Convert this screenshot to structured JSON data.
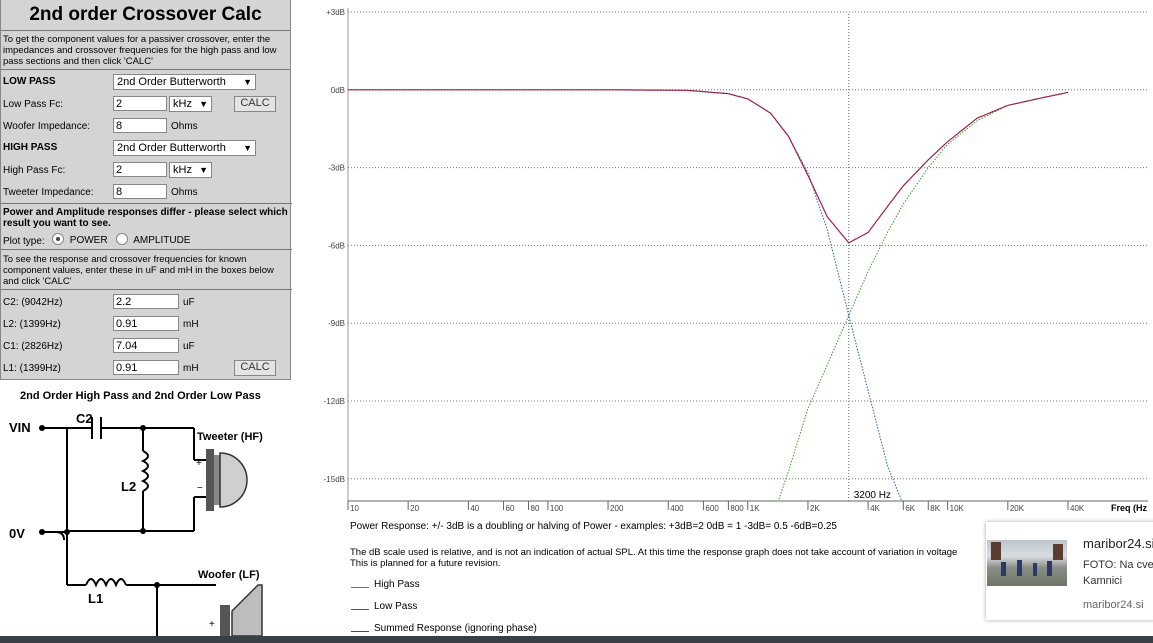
{
  "calculator": {
    "title": "2nd order Crossover Calc",
    "intro": "To get the component values for a passiver crossover, enter the impedances and crossover frequencies for the high pass and low pass sections and then click 'CALC'",
    "low_pass": {
      "heading": "LOW PASS",
      "filter_type": "2nd Order Butterworth",
      "fc_label": "Low Pass Fc:",
      "fc_value": "2",
      "fc_unit": "kHz",
      "calc_label": "CALC",
      "impedance_label": "Woofer Impedance:",
      "impedance_value": "8",
      "impedance_unit": "Ohms"
    },
    "high_pass": {
      "heading": "HIGH PASS",
      "filter_type": "2nd Order Butterworth",
      "fc_label": "High Pass Fc:",
      "fc_value": "2",
      "fc_unit": "kHz",
      "impedance_label": "Tweeter Impedance:",
      "impedance_value": "8",
      "impedance_unit": "Ohms"
    },
    "response_note": "Power and Amplitude responses differ - please select which result you want to see.",
    "plot_type": {
      "label": "Plot type:",
      "options": [
        "POWER",
        "AMPLITUDE"
      ],
      "selected": "POWER"
    },
    "known_intro": "To see the response and crossover frequencies for known component values, enter these in uF and mH in the boxes below and click 'CALC'",
    "components": [
      {
        "label": "C2: (9042Hz)",
        "value": "2.2",
        "unit": "uF"
      },
      {
        "label": "L2: (1399Hz)",
        "value": "0.91",
        "unit": "mH"
      },
      {
        "label": "C1: (2826Hz)",
        "value": "7.04",
        "unit": "uF"
      },
      {
        "label": "L1: (1399Hz)",
        "value": "0.91",
        "unit": "mH"
      }
    ],
    "calc2_label": "CALC"
  },
  "schematic": {
    "title": "2nd Order High Pass and 2nd Order Low Pass",
    "vin": "VIN",
    "zero_v": "0V",
    "c2": "C2",
    "l2": "L2",
    "l1": "L1",
    "tweeter": "Tweeter (HF)",
    "woofer": "Woofer (LF)",
    "plus": "+",
    "minus": "−"
  },
  "chart_data": {
    "type": "line",
    "x_scale": "log",
    "xlim": [
      10,
      40000
    ],
    "ylim": [
      -16,
      3
    ],
    "y_ticks": [
      3,
      0,
      -3,
      -6,
      -9,
      -12,
      -15
    ],
    "y_tick_labels": [
      "+3dB",
      "0dB",
      "-3dB",
      "-6dB",
      "-9dB",
      "-12dB",
      "-15dB"
    ],
    "x_ticks": [
      10,
      20,
      40,
      60,
      80,
      100,
      200,
      400,
      600,
      800,
      1000,
      2000,
      4000,
      6000,
      8000,
      10000,
      20000,
      40000
    ],
    "x_tick_labels": [
      "10",
      "20",
      "40",
      "60",
      "80",
      "100",
      "200",
      "400",
      "600",
      "800",
      "1K",
      "2K",
      "4K",
      "6K",
      "8K",
      "10K",
      "20K",
      "40K"
    ],
    "xlabel": "Freq (Hz",
    "grid": true,
    "marker": {
      "freq": 3200,
      "label": "3200 Hz"
    },
    "series": [
      {
        "name": "High Pass",
        "color": "#3a9a2a",
        "style": "dotted",
        "x": [
          1400,
          1600,
          2000,
          2500,
          3200,
          4000,
          5000,
          6000,
          8000,
          10000,
          14000,
          20000,
          30000,
          40000
        ],
        "y": [
          -16,
          -14.7,
          -12.3,
          -10.6,
          -8.7,
          -7.0,
          -5.5,
          -4.4,
          -3.0,
          -2.1,
          -1.2,
          -0.6,
          -0.3,
          -0.1
        ]
      },
      {
        "name": "Low Pass",
        "color": "#2a5fa8",
        "style": "dotted",
        "x": [
          10,
          200,
          500,
          800,
          1000,
          1300,
          1600,
          2000,
          2500,
          3200,
          4000,
          5000,
          6000
        ],
        "y": [
          0,
          0,
          -0.02,
          -0.15,
          -0.35,
          -0.9,
          -1.8,
          -3.2,
          -5.4,
          -8.7,
          -11.6,
          -14.5,
          -16
        ]
      },
      {
        "name": "Summed Response (ignoring phase)",
        "color": "#a0204a",
        "style": "solid",
        "x": [
          10,
          200,
          500,
          800,
          1000,
          1300,
          1600,
          2000,
          2500,
          3200,
          4000,
          5000,
          6000,
          8000,
          10000,
          14000,
          20000,
          30000,
          40000
        ],
        "y": [
          0,
          0,
          -0.02,
          -0.15,
          -0.35,
          -0.9,
          -1.8,
          -3.3,
          -4.9,
          -5.9,
          -5.5,
          -4.5,
          -3.7,
          -2.7,
          -2.0,
          -1.1,
          -0.6,
          -0.3,
          -0.1
        ]
      }
    ]
  },
  "notes": {
    "power_response": "Power Response: +/- 3dB is a doubling or halving of Power - examples: +3dB=2  0dB = 1  -3dB= 0.5  -6dB=0.25",
    "scale_line1": "The dB scale used is relative, and is not an indication of actual SPL. At this time the response graph does not take account of variation in voltage",
    "scale_line2": "This is planned for a future revision."
  },
  "ad": {
    "title": "maribor24.si",
    "text1": "FOTO: Na cve",
    "text2": "Kamnici",
    "source": "maribor24.si"
  }
}
